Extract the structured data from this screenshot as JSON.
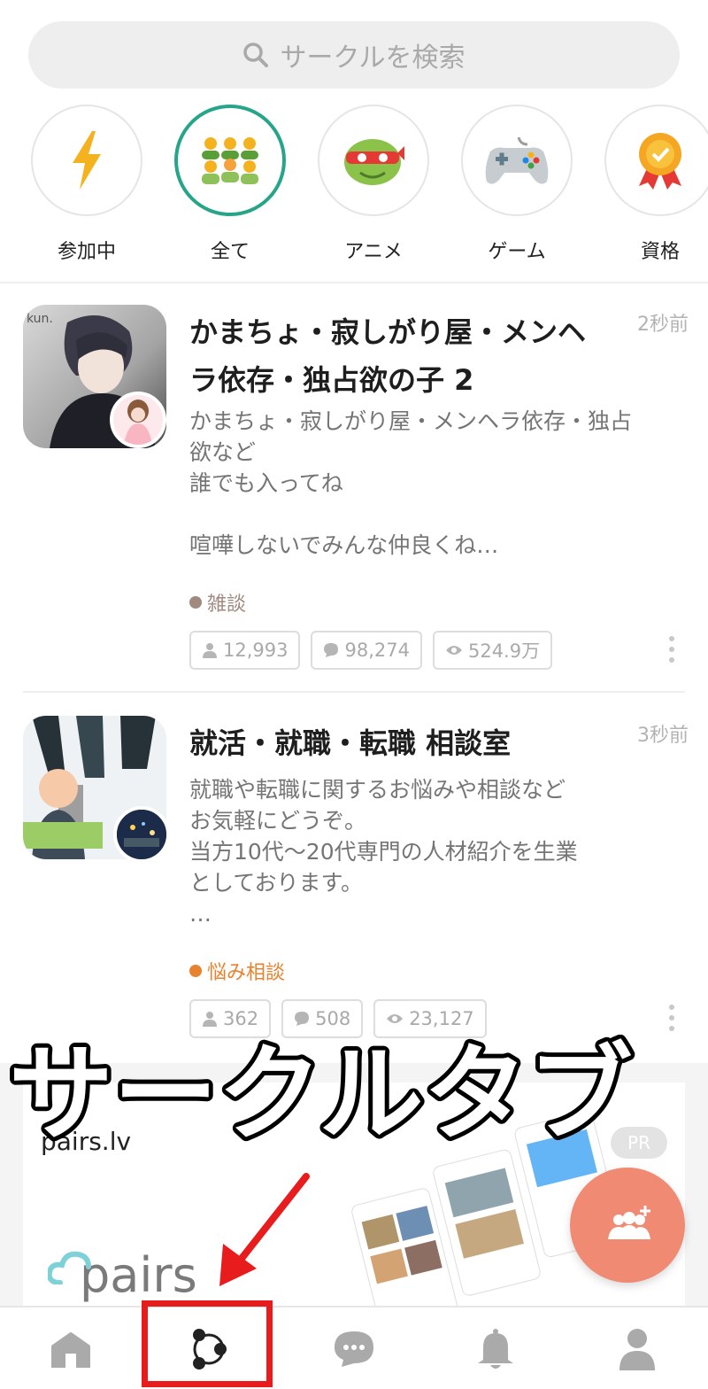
{
  "search": {
    "placeholder": "サークルを検索"
  },
  "categories": [
    {
      "label": "参加中",
      "icon": "lightning-icon"
    },
    {
      "label": "全て",
      "icon": "people-group-icon",
      "active": true
    },
    {
      "label": "アニメ",
      "icon": "turtle-hero-icon"
    },
    {
      "label": "ゲーム",
      "icon": "gamepad-icon"
    },
    {
      "label": "資格",
      "icon": "medal-icon"
    }
  ],
  "posts": [
    {
      "title": "かまちょ・寂しがり屋・メンヘラ依存・独占欲の子 2",
      "time": "2秒前",
      "description": "かまちょ・寂しがり屋・メンヘラ依存・独占欲など\n誰でも入ってね\n\n喧嘩しないでみんな仲良くね…",
      "tag": "雑談",
      "tag_color": "#a08a80",
      "members": "12,993",
      "comments": "98,274",
      "views": "524.9万",
      "thumb_text": "kun."
    },
    {
      "title": "就活・就職・転職 相談室",
      "time": "3秒前",
      "description": "就職や転職に関するお悩みや相談など\nお気軽にどうぞ。\n当方10代〜20代専門の人材紹介を生業\nとしております。\n…",
      "tag": "悩み相談",
      "tag_color": "#e8822e",
      "members": "362",
      "comments": "508",
      "views": "23,127"
    }
  ],
  "ad": {
    "site": "pairs.lv",
    "badge": "PR",
    "logo": "pairs"
  },
  "overlay_caption": "サークルタブ",
  "nav": [
    {
      "name": "home-icon"
    },
    {
      "name": "circle-tab-icon",
      "highlighted": true
    },
    {
      "name": "chat-icon"
    },
    {
      "name": "bell-icon"
    },
    {
      "name": "profile-icon"
    }
  ],
  "colors": {
    "accent": "#26a58a",
    "fab": "#f08a73",
    "highlight": "#e81c1c"
  }
}
